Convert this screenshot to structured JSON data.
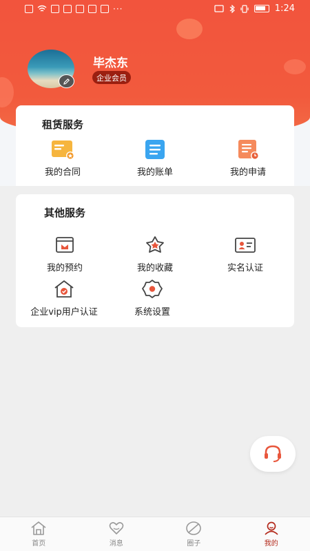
{
  "status_bar": {
    "time": "1:24",
    "dots": "···"
  },
  "profile": {
    "name": "毕杰东",
    "member_badge": "企业会员"
  },
  "rental_services": {
    "title": "租赁服务",
    "items": [
      {
        "label": "我的合同",
        "icon": "contract-icon"
      },
      {
        "label": "我的账单",
        "icon": "bill-icon"
      },
      {
        "label": "我的申请",
        "icon": "application-icon"
      }
    ]
  },
  "other_services": {
    "title": "其他服务",
    "items": [
      {
        "label": "我的预约",
        "icon": "appointment-icon"
      },
      {
        "label": "我的收藏",
        "icon": "favorite-icon"
      },
      {
        "label": "实名认证",
        "icon": "id-card-icon"
      },
      {
        "label": "企业vip用户认证",
        "icon": "enterprise-vip-icon"
      },
      {
        "label": "系统设置",
        "icon": "settings-icon"
      }
    ]
  },
  "tabbar": {
    "tabs": [
      {
        "label": "首页",
        "icon": "home-icon"
      },
      {
        "label": "消息",
        "icon": "message-icon"
      },
      {
        "label": "圈子",
        "icon": "circle-icon"
      },
      {
        "label": "我的",
        "icon": "profile-icon",
        "active": true
      }
    ]
  },
  "colors": {
    "brand": "#f2543d",
    "badge": "#9b1f10",
    "active_tab": "#b3281a"
  }
}
